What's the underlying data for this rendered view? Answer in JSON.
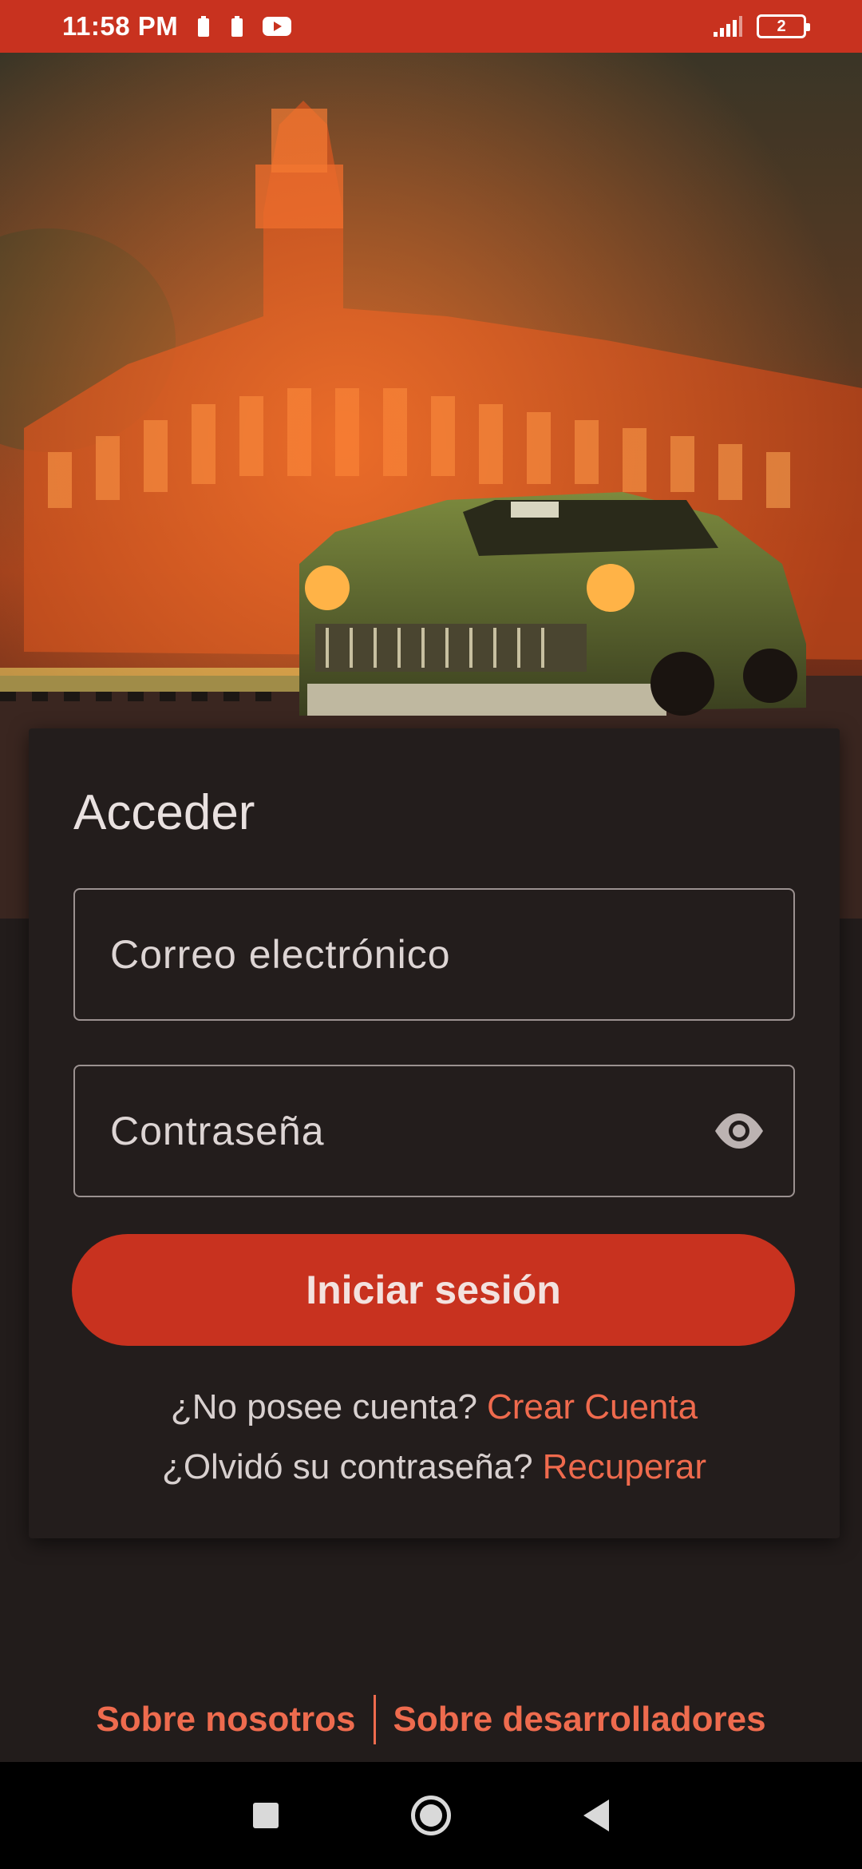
{
  "status_bar": {
    "time": "11:58 PM",
    "battery_level": "2",
    "icons": [
      "battery-icon",
      "battery-icon",
      "youtube-icon",
      "signal-icon"
    ]
  },
  "login": {
    "title": "Acceder",
    "email_placeholder": "Correo electrónico",
    "password_placeholder": "Contraseña",
    "submit_label": "Iniciar sesión",
    "no_account_text": "¿No posee cuenta?",
    "create_account_link": "Crear Cuenta",
    "forgot_text": "¿Olvidó su contraseña?",
    "recover_link": "Recuperar"
  },
  "footer": {
    "about_us": "Sobre nosotros",
    "about_devs": "Sobre desarrolladores"
  },
  "colors": {
    "accent": "#c8321f",
    "link": "#ef6a4d",
    "background": "#221c1b"
  }
}
